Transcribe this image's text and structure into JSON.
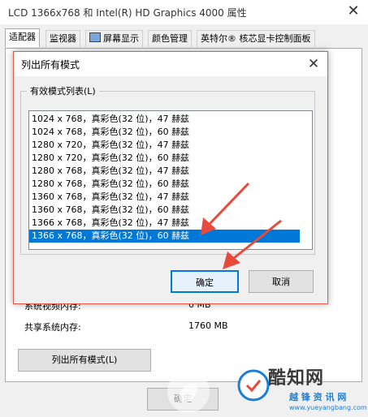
{
  "outer_window": {
    "title": "LCD 1366x768 和 Intel(R) HD Graphics 4000 属性",
    "close_glyph": "✕",
    "tabs": [
      {
        "label": "适配器",
        "active": true
      },
      {
        "label": "监视器"
      },
      {
        "label": "屏幕显示"
      },
      {
        "label": "颜色管理"
      },
      {
        "label": "英特尔® 核芯显卡控制面板"
      }
    ],
    "rows": [
      {
        "label": "系统视频内存:",
        "value": "0 MB"
      },
      {
        "label": "共享系统内存:",
        "value": "1760 MB"
      }
    ],
    "list_all_modes_label": "列出所有模式(L)",
    "ok_label": "确定"
  },
  "dialog": {
    "title": "列出所有模式",
    "close_glyph": "✕",
    "group_label": "有效模式列表(L)",
    "modes": [
      "1024 x 768，真彩色(32 位)，47 赫兹",
      "1024 x 768，真彩色(32 位)，60 赫兹",
      "1280 x 720，真彩色(32 位)，47 赫兹",
      "1280 x 720，真彩色(32 位)，60 赫兹",
      "1280 x 768，真彩色(32 位)，47 赫兹",
      "1280 x 768，真彩色(32 位)，60 赫兹",
      "1360 x 768，真彩色(32 位)，47 赫兹",
      "1360 x 768，真彩色(32 位)，60 赫兹",
      "1366 x 768，真彩色(32 位)，47 赫兹",
      "1366 x 768，真彩色(32 位)，60 赫兹"
    ],
    "selected_index": 9,
    "ok_label": "确定",
    "cancel_label": "取消"
  },
  "watermark": {
    "text": "酷知网",
    "sub": "越 锋 资 讯 网",
    "url": "www.yueyangbang.com"
  },
  "colors": {
    "selection": "#0078d7",
    "arrow": "#e84a3c",
    "dialog_border": "#e85848"
  }
}
